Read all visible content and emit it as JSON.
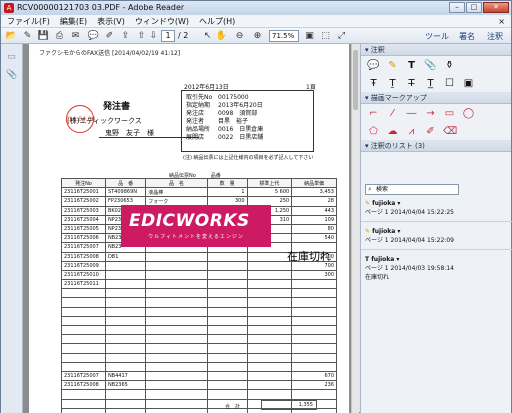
{
  "window": {
    "title": "RCV00000121703 03.PDF - Adobe Reader",
    "minimize": "–",
    "maximize": "□",
    "close": "✕"
  },
  "menu": [
    "ファイル(F)",
    "編集(E)",
    "表示(V)",
    "ウィンドウ(W)",
    "ヘルプ(H)"
  ],
  "menu_close": "×",
  "toolbar": {
    "page_current": "1",
    "page_total": "/ 2",
    "zoom": "71.5%",
    "tools_label": "ツール",
    "sign_label": "署名",
    "comment_label": "注釈"
  },
  "doc": {
    "fax_header": "ファクシモからのFAX送信 [2014/04/02/19 41:12]",
    "stamp": "'14.04.04",
    "date": "2012年6月13日",
    "page_no": "1頁",
    "title": "発注書",
    "company": "(株)エディックワークス",
    "person": "鬼野　友子　様",
    "info": [
      {
        "k": "取引先No",
        "v": "00175000"
      },
      {
        "k": "指定納期",
        "v": "2013年6月20日"
      },
      {
        "k": "発注店",
        "v": "0098　須賀部"
      },
      {
        "k": "発注者",
        "v": "目黒　裕子"
      },
      {
        "k": "納品場所",
        "v": "0016　日黒倉庫"
      },
      {
        "k": "展開店",
        "v": "0022　日黒店舗"
      }
    ],
    "note": "(注) 納品伝票には上記仕様内の項目を必ず記入して下さい",
    "table_caption": "納品伝票No　　　品番",
    "headers": [
      "発注No",
      "品　番",
      "品　名",
      "数　量",
      "標準上代",
      "納品単価"
    ],
    "rows": [
      [
        "23116T25001",
        "ST409869N",
        "液晶棒",
        "1",
        "5 600",
        "3,453"
      ],
      [
        "23116T25002",
        "FP230653",
        "フォーク",
        "300",
        "250",
        "28"
      ],
      [
        "23116T25003",
        "BK0267458PK",
        "ボウル",
        "12",
        "1,250",
        "443"
      ],
      [
        "23116T25004",
        "NP2359490S",
        "鍋ブブキン",
        "500",
        "310",
        "109"
      ],
      [
        "23116T25005",
        "NP2359490S",
        "鍋ブブキン",
        "80",
        "",
        "80"
      ],
      [
        "23116T25006",
        "NB234",
        "",
        "",
        "",
        "540"
      ],
      [
        "23116T25007",
        "NB23",
        "",
        "",
        "",
        ""
      ],
      [
        "23116T25008",
        "DB1",
        "",
        "",
        "",
        "1,100"
      ],
      [
        "23116T25009",
        "",
        "",
        "",
        "",
        "700"
      ],
      [
        "23116T25010",
        "",
        "",
        "",
        "",
        "300"
      ],
      [
        "23116T25011",
        "",
        "",
        "",
        "",
        ""
      ],
      [
        "",
        "",
        "",
        "",
        "",
        ""
      ],
      [
        "",
        "",
        "",
        "",
        "",
        ""
      ],
      [
        "",
        "",
        "",
        "",
        "",
        ""
      ],
      [
        "",
        "",
        "",
        "",
        "",
        ""
      ],
      [
        "",
        "",
        "",
        "",
        "",
        ""
      ],
      [
        "",
        "",
        "",
        "",
        "",
        ""
      ],
      [
        "",
        "",
        "",
        "",
        "",
        ""
      ],
      [
        "",
        "",
        "",
        "",
        "",
        ""
      ],
      [
        "",
        "",
        "",
        "",
        "",
        ""
      ],
      [
        "23116T25007",
        "NB4417",
        "",
        "",
        "",
        "670"
      ],
      [
        "23116T25008",
        "NB2365",
        "",
        "",
        "",
        "236"
      ],
      [
        "",
        "",
        "",
        "",
        "",
        ""
      ],
      [
        "",
        "",
        "",
        "",
        "",
        ""
      ],
      [
        "",
        "",
        "",
        "",
        "",
        ""
      ]
    ],
    "total_label": "合　計",
    "total_value": "1,355",
    "logo_text": "EDICWORKS",
    "logo_sub": "ウルフィトメントを変えるエンジン",
    "annotation_text": "在庫切れ"
  },
  "panel": {
    "comments_header": "▾ 注釈",
    "drawing_header": "▾ 描画マークアップ",
    "list_header": "▾ 注釈のリスト (3)",
    "search_placeholder": "検索",
    "comments": [
      {
        "author": "fujioka",
        "meta": "ページ 1  2014/04/04 15:22:25",
        "body": ""
      },
      {
        "author": "fujioka",
        "meta": "ページ 1  2014/04/04 15:22:09",
        "body": ""
      },
      {
        "author": "fujioka",
        "meta": "ページ 1  2014/04/03 19:58:14",
        "body": "在庫切れ"
      }
    ]
  },
  "colors": {
    "logo_bg": "#cc1a63",
    "stamp": "#d32222"
  }
}
